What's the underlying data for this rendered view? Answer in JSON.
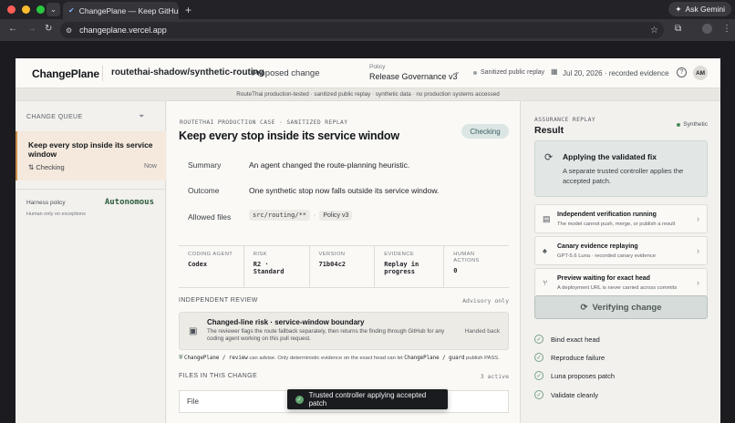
{
  "browser": {
    "tab_title": "ChangePlane — Keep GitHub",
    "url": "changeplane.vercel.app",
    "gemini_label": "Ask Gemini"
  },
  "header": {
    "logo": "ChangePlane",
    "repo": "routethai-shadow/synthetic-routing",
    "proposed": "Proposed change",
    "policy_label": "Policy",
    "policy_value": "Release Governance v3",
    "sanitized": "Sanitized public replay",
    "date_evidence": "Jul 20, 2026 · recorded evidence",
    "avatar": "AM"
  },
  "banner": "RouteThai production-tested · sanitized public replay · synthetic data · no production systems accessed",
  "queue": {
    "title": "CHANGE QUEUE",
    "item_title": "Keep every stop inside its service window",
    "item_status": "Checking",
    "item_time": "Now",
    "harness_label": "Harness policy",
    "harness_value": "Autonomous",
    "harness_sub": "Human only on exceptions"
  },
  "main": {
    "case_label": "ROUTETHAI PRODUCTION CASE · SANITIZED REPLAY",
    "title": "Keep every stop inside its service window",
    "status_pill": "Checking",
    "summary_label": "Summary",
    "summary_value": "An agent changed the route-planning heuristic.",
    "outcome_label": "Outcome",
    "outcome_value": "One synthetic stop now falls outside its service window.",
    "files_label": "Allowed files",
    "files_chip1": "src/routing/**",
    "files_sep": "·",
    "files_chip2": "Policy v3",
    "meta": [
      {
        "label": "CODING AGENT",
        "value": "Codex"
      },
      {
        "label": "RISK",
        "value": "R2 · Standard"
      },
      {
        "label": "VERSION",
        "value": "71b04c2"
      },
      {
        "label": "EVIDENCE",
        "value": "Replay in progress"
      },
      {
        "label": "HUMAN ACTIONS",
        "value": "0"
      }
    ],
    "review_title": "INDEPENDENT REVIEW",
    "review_adv": "Advisory only",
    "review_box_title": "Changed-line risk · service-window boundary",
    "review_box_desc": "The reviewer flags the route fallback separately, then returns the finding through GitHub for any coding agent working on this pull request.",
    "review_box_status": "Handed back",
    "advise_m1": "ChangePlane / review",
    "advise_t1": " can advise. Only deterministic evidence on the exact head can let ",
    "advise_m2": "ChangePlane / guard",
    "advise_t2": " publish PASS.",
    "files_title": "FILES IN THIS CHANGE",
    "files_count": "3 active",
    "file_header": "File"
  },
  "right": {
    "assurance": "ASSURANCE REPLAY",
    "result": "Result",
    "synthetic": "Synthetic",
    "applying_title": "Applying the validated fix",
    "applying_desc": "A separate trusted controller applies the accepted patch.",
    "steps": [
      {
        "title": "Independent verification running",
        "desc": "The model cannot push, merge, or publish a result"
      },
      {
        "title": "Canary evidence replaying",
        "desc": "GPT-5.6 Luna · recorded canary evidence"
      },
      {
        "title": "Preview waiting for exact head",
        "desc": "A deployment URL is never carried across commits"
      }
    ],
    "verify_btn": "Verifying change",
    "checks": [
      "Bind exact head",
      "Reproduce failure",
      "Luna proposes patch",
      "Validate cleanly"
    ]
  },
  "toast": "Trusted controller applying accepted patch"
}
